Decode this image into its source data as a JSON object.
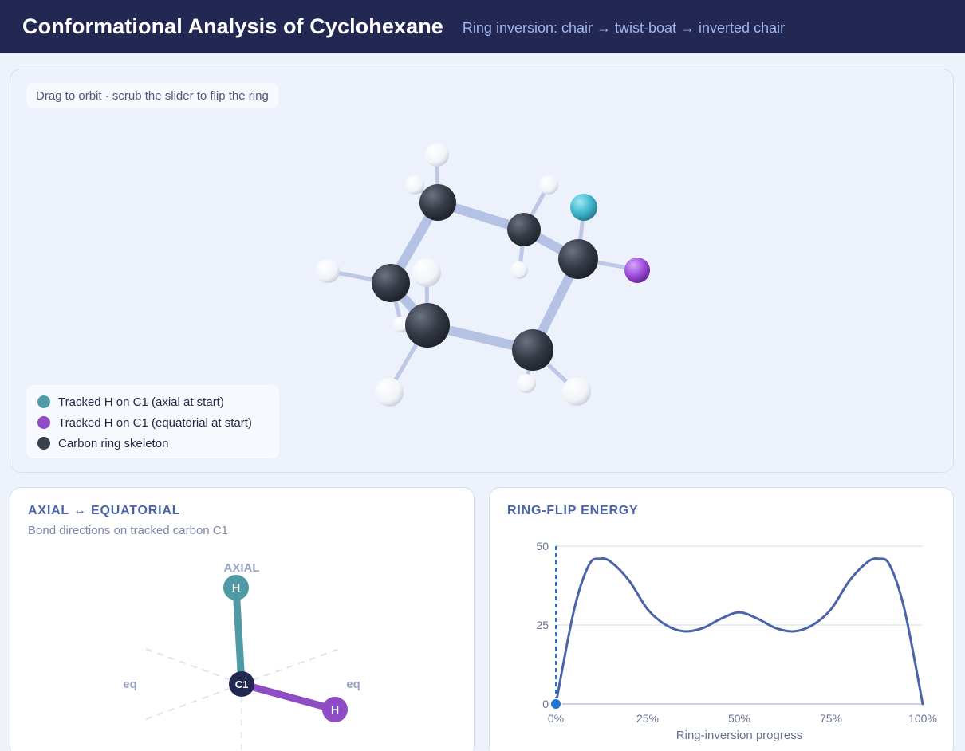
{
  "header": {
    "title": "Conformational Analysis of Cyclohexane",
    "subtitle": "Ring inversion: chair → twist-boat → inverted chair"
  },
  "viewer": {
    "hint": "Drag to orbit · scrub the slider to flip the ring",
    "legend": [
      {
        "label": "Tracked H on C1 (axial at start)",
        "color": "#4f9aa5"
      },
      {
        "label": "Tracked H on C1 (equatorial at start)",
        "color": "#8e4cc5"
      },
      {
        "label": "Carbon ring skeleton",
        "color": "#3a3f4c"
      }
    ]
  },
  "axial_card": {
    "title": "AXIAL ↔ EQUATORIAL",
    "subtitle": "Bond directions on tracked carbon C1",
    "axial_label": "AXIAL",
    "eq_left_label": "eq",
    "eq_right_label": "eq",
    "center_label": "C1",
    "axial_h_label": "H",
    "eq_h_label": "H"
  },
  "energy_card": {
    "title": "RING-FLIP ENERGY"
  },
  "chart_data": {
    "type": "line",
    "title": "RING-FLIP ENERGY",
    "xlabel": "Ring-inversion progress",
    "ylabel": "",
    "x": [
      0,
      0.05,
      0.09,
      0.12,
      0.15,
      0.2,
      0.25,
      0.3,
      0.35,
      0.4,
      0.45,
      0.5,
      0.55,
      0.6,
      0.65,
      0.7,
      0.75,
      0.8,
      0.85,
      0.88,
      0.91,
      0.95,
      1.0
    ],
    "y": [
      0,
      30,
      44,
      46,
      45,
      39,
      30,
      25,
      23,
      24,
      27,
      29,
      27,
      24,
      23,
      25,
      30,
      39,
      45,
      46,
      44,
      30,
      0
    ],
    "xlim": [
      0,
      1
    ],
    "ylim": [
      0,
      50
    ],
    "xticks": [
      "0%",
      "25%",
      "50%",
      "75%",
      "100%"
    ],
    "yticks": [
      "0",
      "25",
      "50"
    ],
    "current_progress": 0,
    "grid": true,
    "line_color": "#4a63ab",
    "marker_color": "#1f74d6"
  }
}
